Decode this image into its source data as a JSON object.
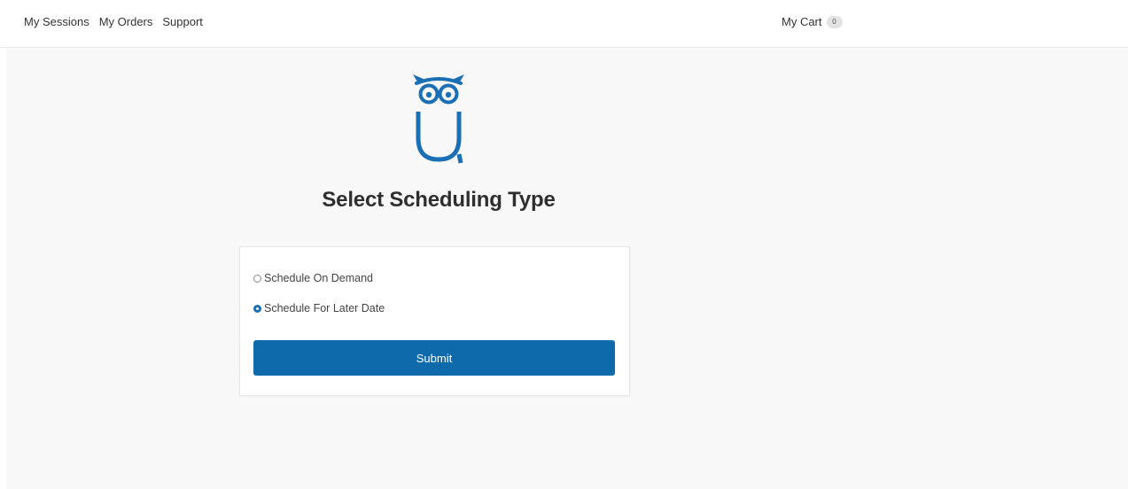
{
  "header": {
    "nav": [
      {
        "label": "My Sessions"
      },
      {
        "label": "My Orders"
      },
      {
        "label": "Support"
      }
    ],
    "cart": {
      "label": "My Cart",
      "count": "0"
    }
  },
  "logo": {
    "icon": "owl-icon",
    "color": "#1b6fb4"
  },
  "page": {
    "title": "Select Scheduling Type"
  },
  "form": {
    "options": [
      {
        "label": "Schedule On Demand",
        "checked": false
      },
      {
        "label": "Schedule For Later Date",
        "checked": true
      }
    ],
    "submit_label": "Submit"
  },
  "colors": {
    "accent": "#0f6aab",
    "background": "#f8f8f8"
  }
}
